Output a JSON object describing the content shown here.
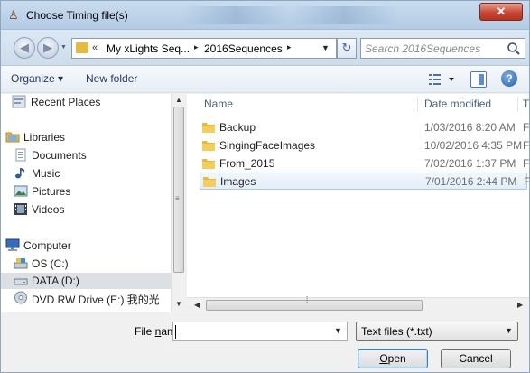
{
  "window": {
    "title": "Choose Timing file(s)",
    "close_glyph": "✕"
  },
  "nav": {
    "back_icon": "back-arrow-icon",
    "forward_icon": "forward-arrow-icon"
  },
  "address": {
    "prefix": "«",
    "segments": [
      "My xLights Seq...",
      "2016Sequences"
    ],
    "separator": "▸"
  },
  "search": {
    "placeholder": "Search 2016Sequences"
  },
  "toolbar": {
    "organize": "Organize ▾",
    "new_folder": "New folder"
  },
  "sidebar": {
    "items": [
      {
        "label": "Recent Places",
        "icon": "recent-places-icon"
      },
      {
        "label": "Libraries",
        "icon": "libraries-icon"
      },
      {
        "label": "Documents",
        "icon": "documents-icon"
      },
      {
        "label": "Music",
        "icon": "music-icon"
      },
      {
        "label": "Pictures",
        "icon": "pictures-icon"
      },
      {
        "label": "Videos",
        "icon": "videos-icon"
      },
      {
        "label": "Computer",
        "icon": "computer-icon"
      },
      {
        "label": "OS (C:)",
        "icon": "drive-icon"
      },
      {
        "label": "DATA (D:)",
        "icon": "drive-icon",
        "selected": true
      },
      {
        "label": "DVD RW Drive (E:) 我的光",
        "icon": "dvd-drive-icon"
      }
    ]
  },
  "file_list": {
    "columns": [
      "Name",
      "Date modified",
      "T"
    ],
    "rows": [
      {
        "name": "Backup",
        "date": "1/03/2016 8:20 AM",
        "type": "F"
      },
      {
        "name": "SingingFaceImages",
        "date": "10/02/2016 4:35 PM",
        "type": "F"
      },
      {
        "name": "From_2015",
        "date": "7/02/2016 1:37 PM",
        "type": "F"
      },
      {
        "name": "Images",
        "date": "7/01/2016 2:44 PM",
        "type": "F",
        "selected": true
      }
    ]
  },
  "footer": {
    "file_name_label_pre": "File ",
    "file_name_label_accel": "n",
    "file_name_label_post": "ame:",
    "file_name_value": "",
    "file_type": "Text files (*.txt)",
    "open_accel": "O",
    "open_rest": "pen",
    "cancel": "Cancel"
  },
  "colors": {
    "folder": "#e6b93f",
    "selection": "#cce4f7",
    "title_bar": "#c9dcef",
    "close": "#c94733"
  }
}
